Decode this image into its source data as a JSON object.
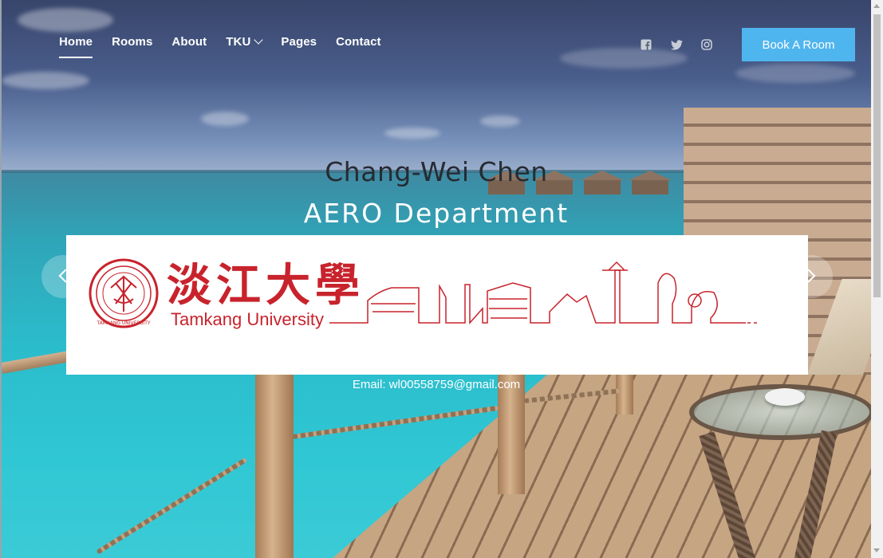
{
  "nav": {
    "items": [
      {
        "label": "Home",
        "active": true
      },
      {
        "label": "Rooms"
      },
      {
        "label": "About"
      },
      {
        "label": "TKU",
        "has_dropdown": true
      },
      {
        "label": "Pages"
      },
      {
        "label": "Contact"
      }
    ]
  },
  "social": {
    "icons": [
      "facebook-icon",
      "twitter-icon",
      "instagram-icon"
    ],
    "color": "#c8ced6"
  },
  "book_button": {
    "label": "Book A Room",
    "color": "#4fb5ee"
  },
  "hero": {
    "name": "Chang-Wei Chen",
    "department": "AERO Department",
    "email": "Email: wl00558759@gmail.com"
  },
  "logo": {
    "chinese_name": "淡江大學",
    "english_name": "Tamkang University",
    "seal_text": "TAMKANG UNIVERSITY",
    "brand_color": "#c8232c"
  },
  "carousel": {
    "prev_icon": "chevron-left-icon",
    "next_icon": "chevron-right-icon"
  }
}
